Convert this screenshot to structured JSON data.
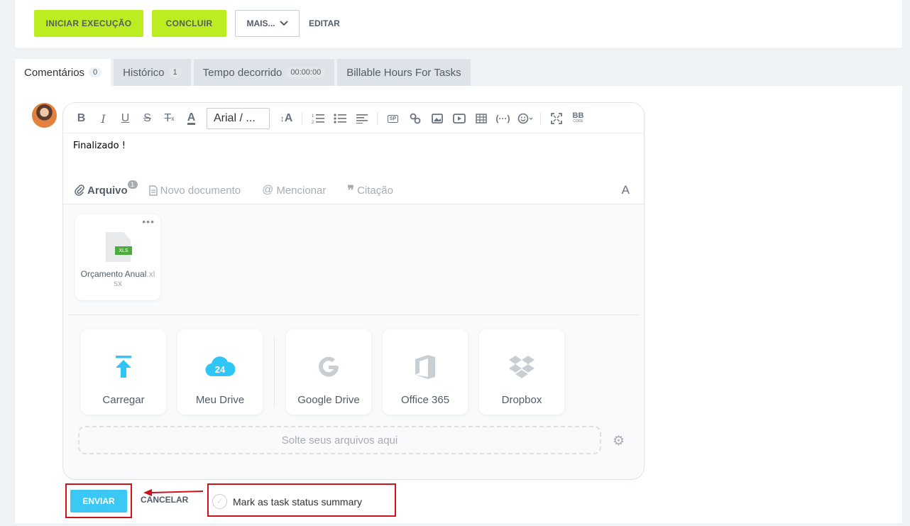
{
  "topbar": {
    "start_label": "INICIAR EXECUÇÃO",
    "complete_label": "CONCLUIR",
    "more_label": "MAIS...",
    "edit_label": "EDITAR"
  },
  "tabs": [
    {
      "label": "Comentários",
      "count": "0"
    },
    {
      "label": "Histórico",
      "count": "1"
    },
    {
      "label": "Tempo decorrido",
      "count": "00:00:00"
    },
    {
      "label": "Billable Hours For Tasks"
    }
  ],
  "editor": {
    "font_value": "Arial / ...",
    "content": "Finalizado !",
    "toolbar": [
      "bold",
      "italic",
      "underline",
      "strikethrough",
      "clear-format",
      "text-color",
      "font-family",
      "font-size",
      "numbered-list",
      "bulleted-list",
      "align",
      "spoiler",
      "link",
      "image",
      "video",
      "table",
      "code",
      "emoji",
      "fullscreen",
      "bbcode"
    ],
    "bb_label": "BB",
    "code_label": "CODE",
    "sp_label": "SP"
  },
  "attach_bar": {
    "file_label": "Arquivo",
    "file_count": "1",
    "new_doc_label": "Novo documento",
    "mention_label": "Mencionar",
    "quote_label": "Citação",
    "font_toggle": "A"
  },
  "file": {
    "name": "Orçamento Anual",
    "ext": ".xlsx",
    "badge": "XLS",
    "menu": "•••"
  },
  "sources": [
    {
      "label": "Carregar",
      "icon": "upload-icon"
    },
    {
      "label": "Meu Drive",
      "icon": "cloud-24-icon",
      "badge": "24"
    },
    {
      "label": "Google Drive",
      "icon": "google-icon"
    },
    {
      "label": "Office 365",
      "icon": "office-icon"
    },
    {
      "label": "Dropbox",
      "icon": "dropbox-icon"
    }
  ],
  "dropzone": {
    "label": "Solte seus arquivos aqui"
  },
  "footer": {
    "send_label": "ENVIAR",
    "cancel_label": "CANCELAR",
    "summary_label": "Mark as task status summary"
  },
  "colors": {
    "green": "#bbed21",
    "send": "#3bc8f5",
    "highlight": "#d0121b"
  }
}
